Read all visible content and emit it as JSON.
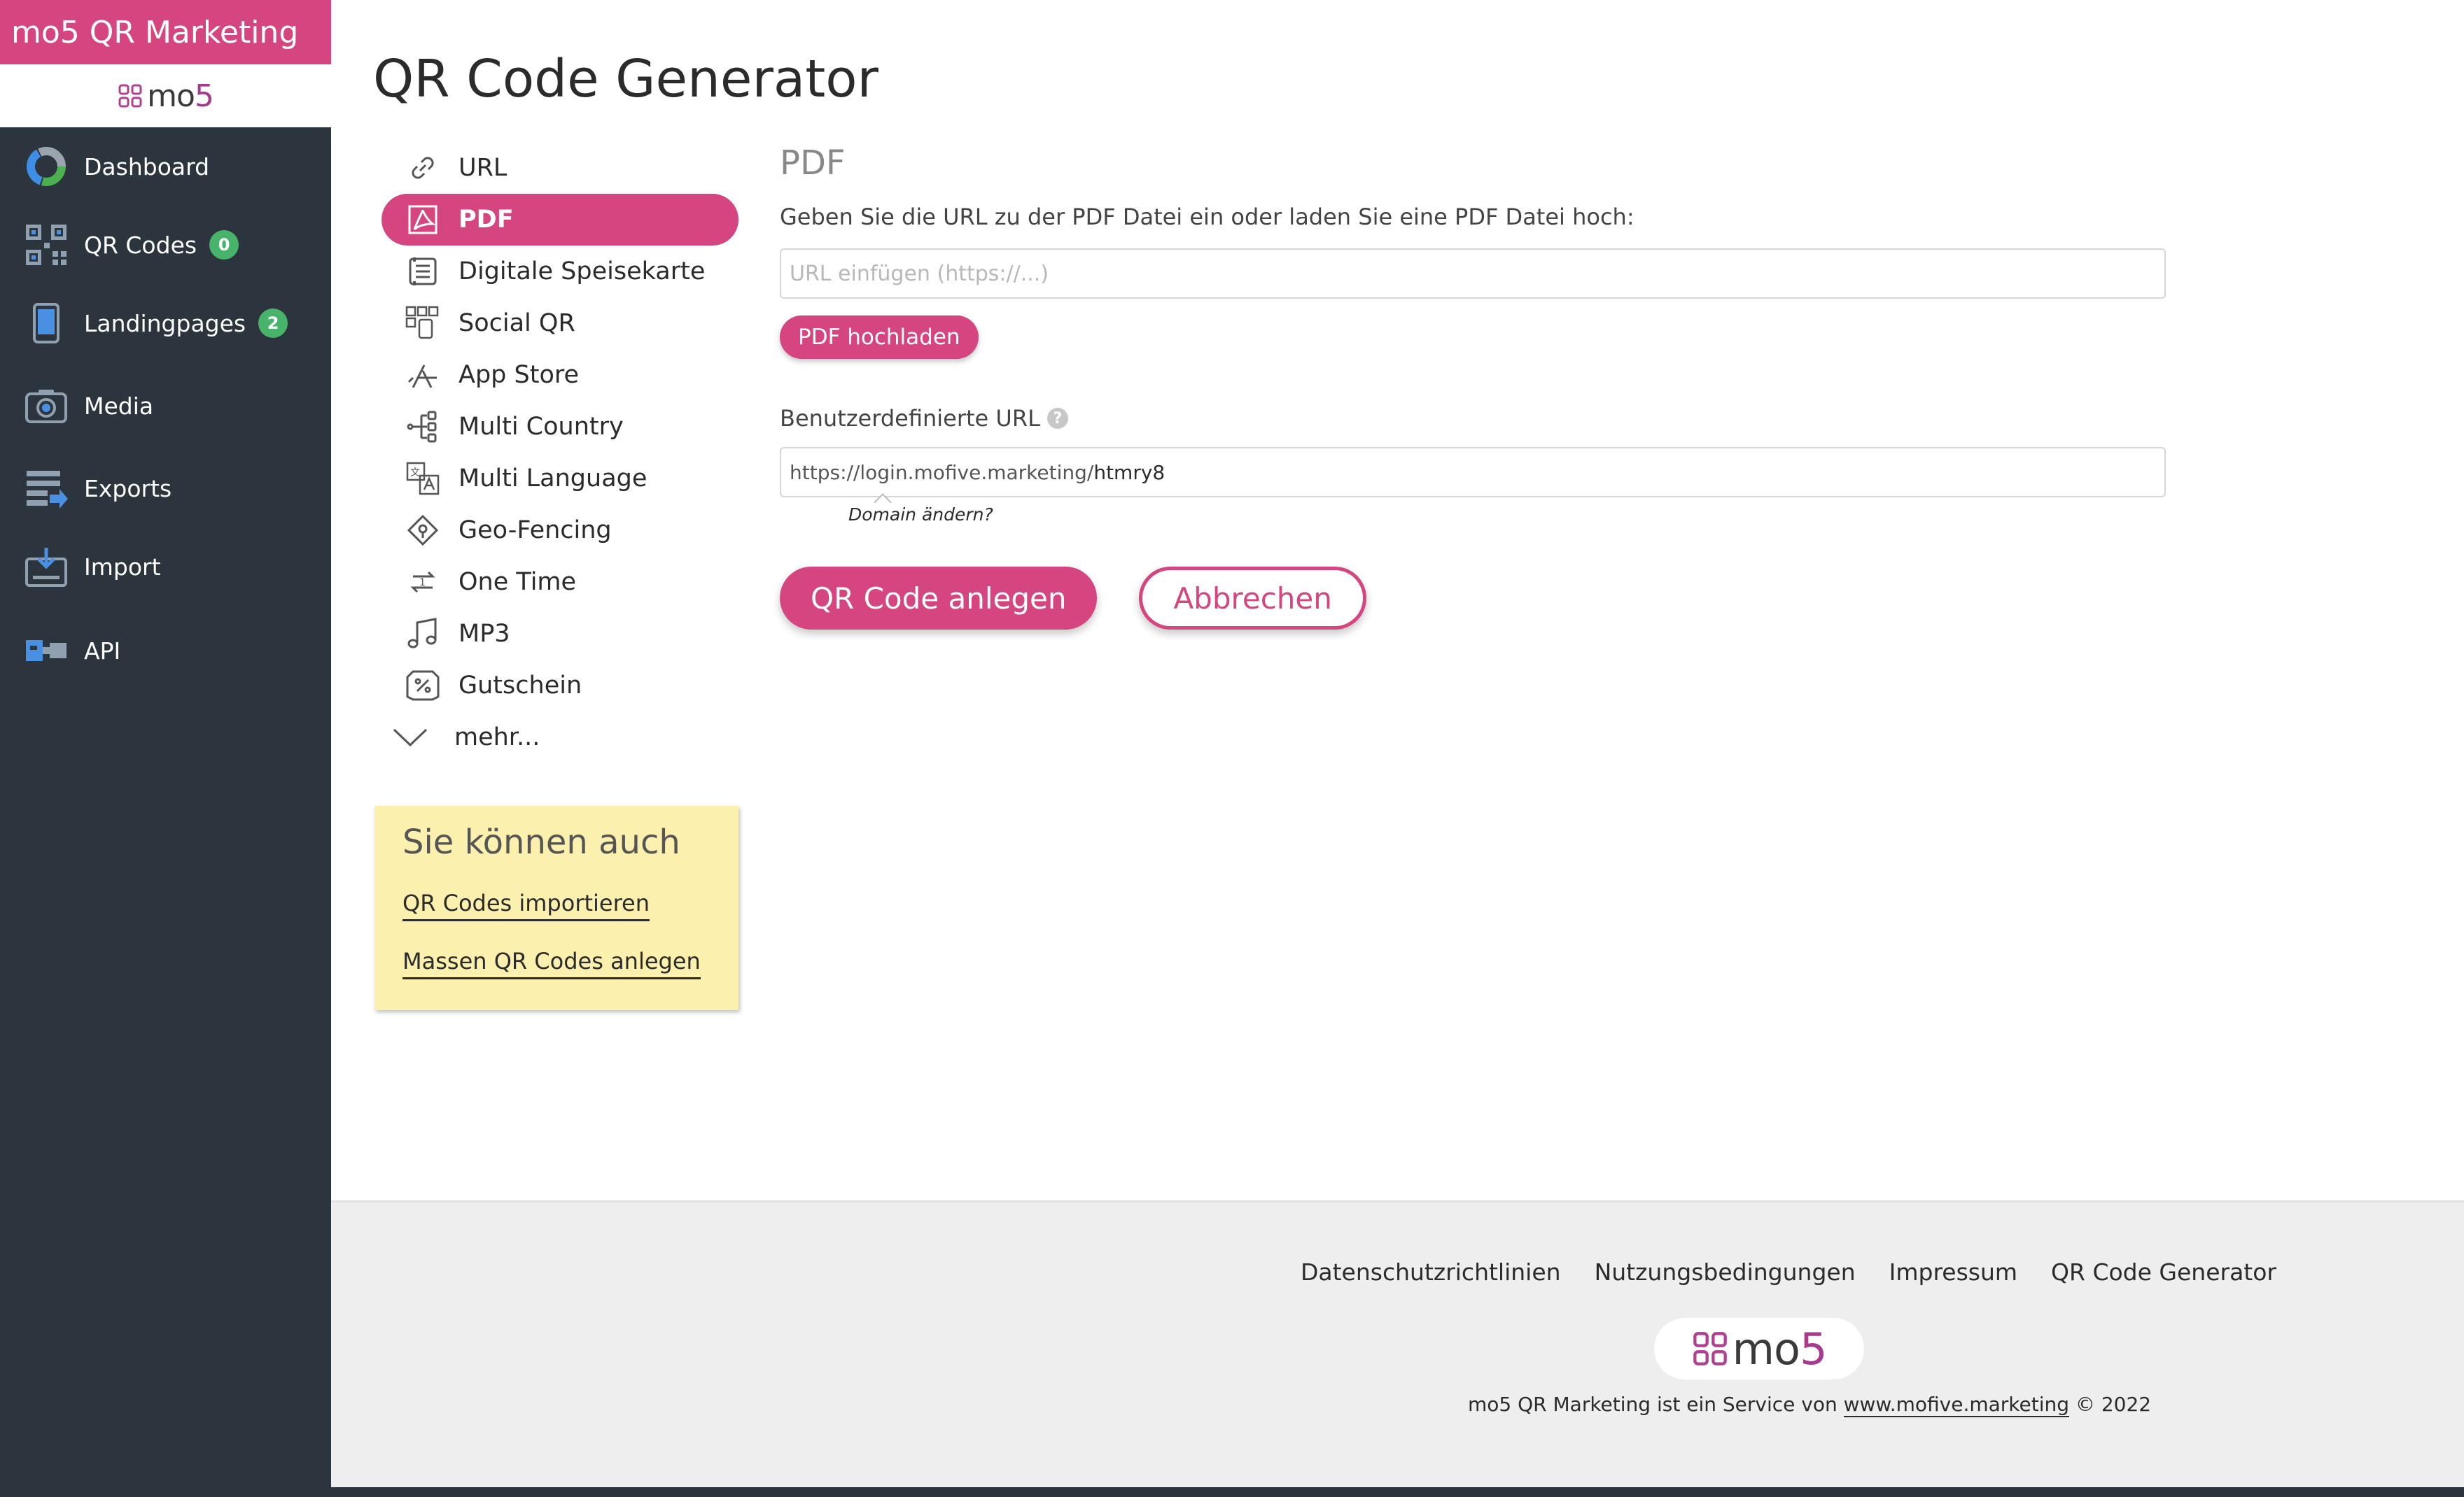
{
  "app": {
    "title": "mo5 QR Marketing",
    "logo_text": "mo",
    "logo_digit": "5"
  },
  "sidebar": {
    "items": [
      {
        "label": "Dashboard",
        "icon": "dashboard-donut-icon"
      },
      {
        "label": "QR Codes",
        "icon": "qr-code-icon",
        "badge": "0"
      },
      {
        "label": "Landingpages",
        "icon": "tablet-icon",
        "badge": "2"
      },
      {
        "label": "Media",
        "icon": "camera-icon"
      },
      {
        "label": "Exports",
        "icon": "export-icon"
      },
      {
        "label": "Import",
        "icon": "import-icon"
      },
      {
        "label": "API",
        "icon": "api-icon"
      }
    ]
  },
  "page": {
    "title": "QR Code Generator"
  },
  "types": {
    "items": [
      {
        "label": "URL",
        "icon": "link-icon"
      },
      {
        "label": "PDF",
        "icon": "pdf-icon"
      },
      {
        "label": "Digitale Speisekarte",
        "icon": "menu-card-icon"
      },
      {
        "label": "Social QR",
        "icon": "social-qr-icon"
      },
      {
        "label": "App Store",
        "icon": "app-store-icon"
      },
      {
        "label": "Multi Country",
        "icon": "multi-country-icon"
      },
      {
        "label": "Multi Language",
        "icon": "multi-language-icon"
      },
      {
        "label": "Geo-Fencing",
        "icon": "geo-fencing-icon"
      },
      {
        "label": "One Time",
        "icon": "one-time-icon"
      },
      {
        "label": "MP3",
        "icon": "music-note-icon"
      },
      {
        "label": "Gutschein",
        "icon": "coupon-icon"
      },
      {
        "label": "mehr...",
        "icon": "chevron-down-icon"
      }
    ],
    "active": "PDF"
  },
  "hint": {
    "title": "Sie können auch",
    "links": [
      "QR Codes importieren",
      "Massen QR Codes anlegen"
    ]
  },
  "form": {
    "section_title": "PDF",
    "instruction": "Geben Sie die URL zu der PDF Datei ein oder laden Sie eine PDF Datei hoch:",
    "url_placeholder": "URL einfügen (https://...)",
    "url_value": "",
    "upload_button": "PDF hochladen",
    "custom_url_label": "Benutzerdefinierte URL",
    "custom_url_prefix": "https://login.mofive.marketing/",
    "custom_url_slug": "htmry8",
    "domain_change": "Domain ändern?",
    "submit_button": "QR Code anlegen",
    "cancel_button": "Abbrechen"
  },
  "footer": {
    "links": [
      "Datenschutzrichtlinien",
      "Nutzungsbedingungen",
      "Impressum",
      "QR Code Generator"
    ],
    "note_prefix": "mo5 QR Marketing ist ein Service von ",
    "note_link": "www.mofive.marketing",
    "note_suffix": " © 2022"
  },
  "colors": {
    "accent": "#d5457f",
    "sidebar_bg": "#2c343e",
    "badge_green": "#48b36b",
    "hint_bg": "#fbf0ad"
  }
}
